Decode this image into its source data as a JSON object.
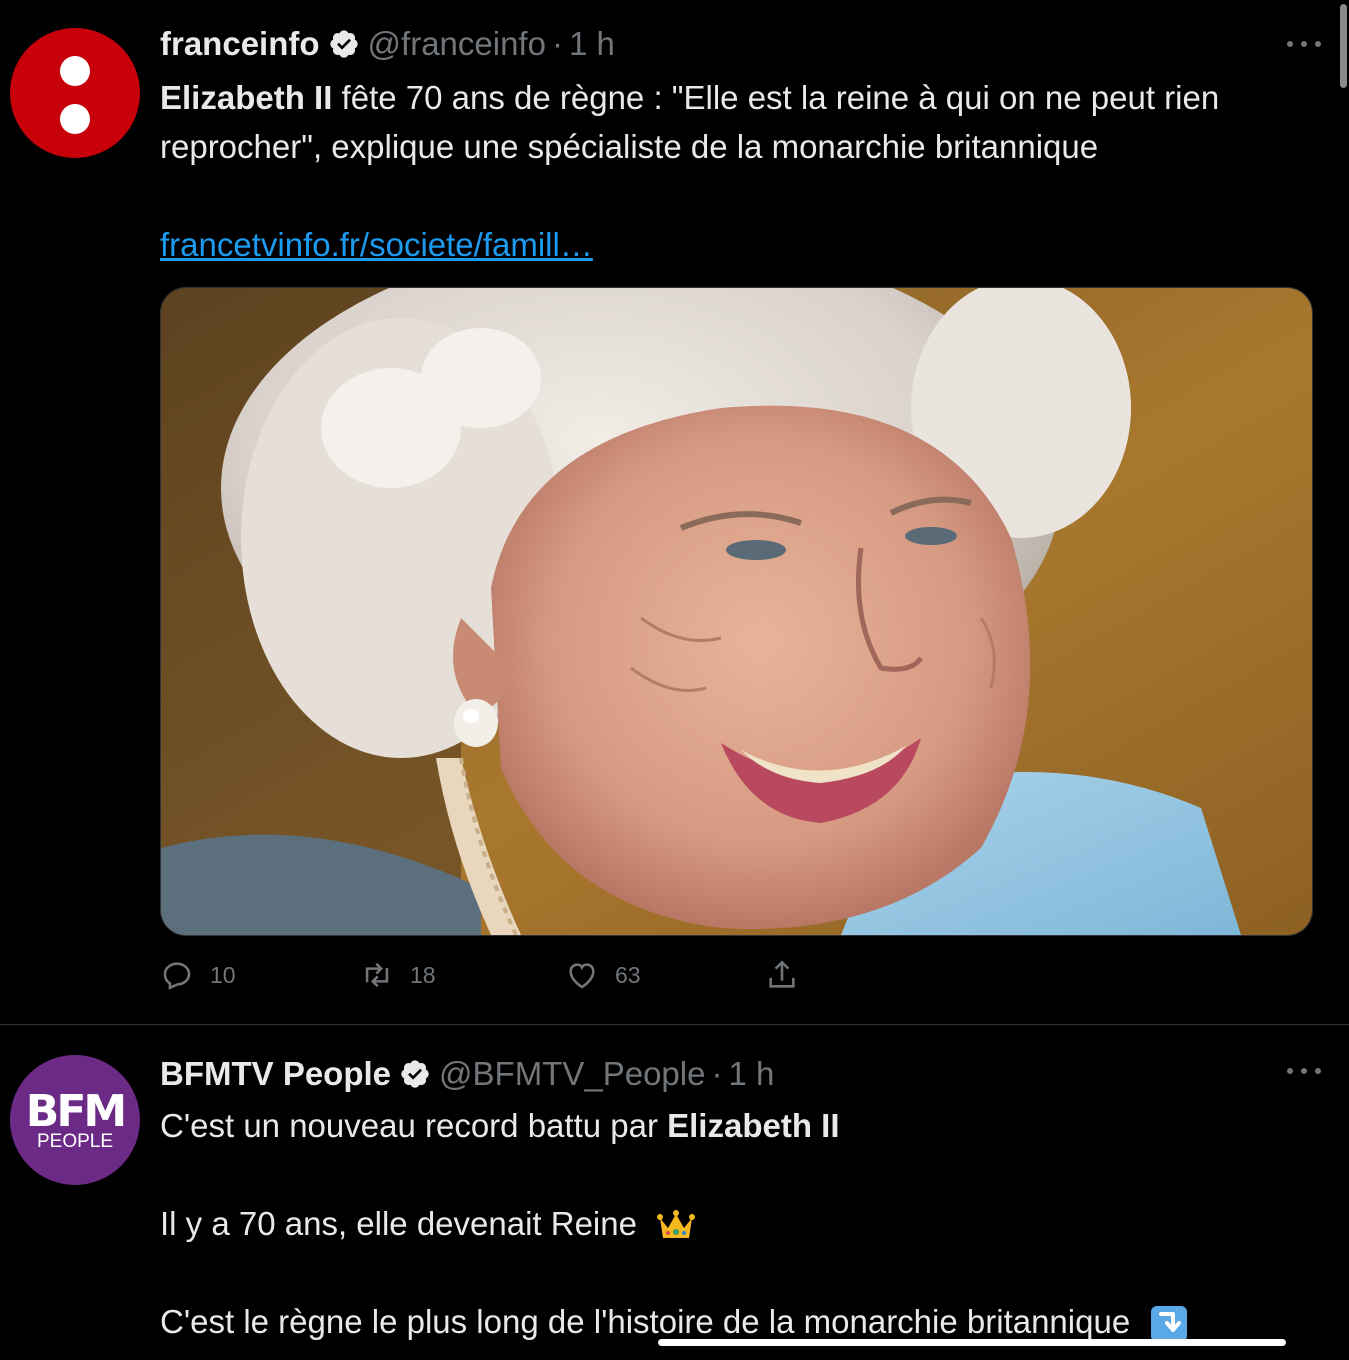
{
  "tweets": [
    {
      "author": "franceinfo",
      "handle": "@franceinfo",
      "separator": "·",
      "time": "1 h",
      "text_bold": "Elizabeth II",
      "text_rest": " fête 70 ans de règne : \"Elle est la reine à qui on ne peut rien reprocher\", explique une spécialiste de la monarchie britannique",
      "link": "francetvinfo.fr/societe/famill…",
      "actions": {
        "reply_count": "10",
        "retweet_count": "18",
        "like_count": "63"
      },
      "avatar_color": "#c8000a"
    },
    {
      "author": "BFMTV People",
      "handle": "@BFMTV_People",
      "separator": "·",
      "time": "1 h",
      "line1_text": "C'est un nouveau record battu par ",
      "line1_bold": "Elizabeth II",
      "line2_text": "Il y a 70 ans, elle devenait Reine",
      "line3_text": "C'est le règne le plus long de l'histoire de la monarchie britannique",
      "avatar_logo_big": "BFM",
      "avatar_logo_small": "PEOPLE",
      "avatar_color": "#6b2a86",
      "line2_emoji": "crown-emoji",
      "line3_emoji": "arrow-down-right-emoji"
    }
  ],
  "colors": {
    "background": "#000000",
    "text": "#e7e9ea",
    "muted": "#71767b",
    "link": "#1d9bf0",
    "divider": "#2f3336"
  }
}
